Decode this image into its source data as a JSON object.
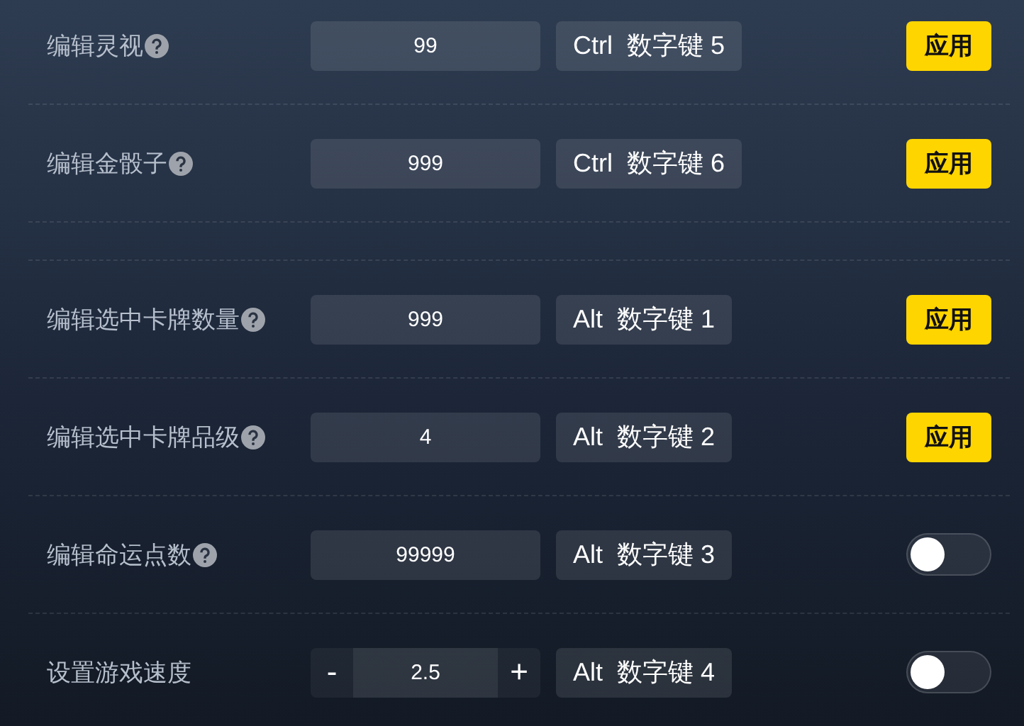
{
  "groups": [
    {
      "rows": [
        {
          "label": "编辑灵视",
          "help": true,
          "input": {
            "kind": "field",
            "value": "99"
          },
          "hotkey": "Ctrl  数字键 5",
          "action": {
            "kind": "apply",
            "label": "应用"
          }
        },
        {
          "label": "编辑金骰子",
          "help": true,
          "input": {
            "kind": "field",
            "value": "999"
          },
          "hotkey": "Ctrl  数字键 6",
          "action": {
            "kind": "apply",
            "label": "应用"
          }
        }
      ]
    },
    {
      "rows": [
        {
          "label": "编辑选中卡牌数量",
          "help": true,
          "input": {
            "kind": "field",
            "value": "999"
          },
          "hotkey": "Alt  数字键 1",
          "action": {
            "kind": "apply",
            "label": "应用"
          }
        },
        {
          "label": "编辑选中卡牌品级",
          "help": true,
          "input": {
            "kind": "field",
            "value": "4"
          },
          "hotkey": "Alt  数字键 2",
          "action": {
            "kind": "apply",
            "label": "应用"
          }
        },
        {
          "label": "编辑命运点数",
          "help": true,
          "input": {
            "kind": "field",
            "value": "99999"
          },
          "hotkey": "Alt  数字键 3",
          "action": {
            "kind": "toggle",
            "on": false
          }
        },
        {
          "label": "设置游戏速度",
          "help": false,
          "input": {
            "kind": "stepper",
            "value": "2.5",
            "minus": "-",
            "plus": "+"
          },
          "hotkey": "Alt  数字键 4",
          "action": {
            "kind": "toggle",
            "on": false
          }
        }
      ]
    }
  ]
}
